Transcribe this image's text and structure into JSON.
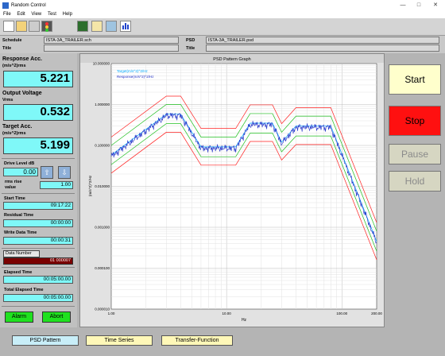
{
  "window": {
    "title": "Random Control"
  },
  "menu": [
    "File",
    "Edit",
    "View",
    "Test",
    "Help"
  ],
  "toolbar": {
    "icons": [
      "new-icon",
      "open-icon",
      "print-icon",
      "traffic-light-icon",
      "monitor-icon",
      "graph-icon",
      "window-icon",
      "bar-chart-icon"
    ]
  },
  "info": {
    "schedule_label": "Schedule",
    "schedule_value": "ISTA-3A_TRAILER.sch",
    "title_label": "Title",
    "title_value": "",
    "psd_label": "PSD",
    "psd_value": "ISTA-3A_TRAILER.psd",
    "title2_label": "Title",
    "title2_value": ""
  },
  "left": {
    "response_label": "Response Acc.",
    "response_unit": "(m/s^2)rms",
    "response_value": "5.221",
    "output_label": "Output Voltage",
    "output_unit": "Vrms",
    "output_value": "0.532",
    "target_label": "Target Acc.",
    "target_unit": "(m/s^2)rms",
    "target_value": "5.199",
    "drive_label": "Drive Level dB",
    "drive_value": "0.00",
    "rms_label": "rms rise",
    "rms_label2": "value",
    "rms_value": "1.00",
    "start_label": "Start Time",
    "start_value": "09:17:22",
    "residual_label": "Residual Time",
    "residual_value": "00:00:00",
    "write_label": "Write Data Time",
    "write_value": "00:00:31",
    "data_label": "Data Number",
    "data_value": "01 000007",
    "elapsed_label": "Elapsed Time",
    "elapsed_value": "00:05:00.00",
    "total_label": "Total Elapsed Time",
    "total_value": "00:05:00.00",
    "alarm_label": "Alarm",
    "abort_label": "Abort"
  },
  "right": {
    "start": "Start",
    "stop": "Stop",
    "pause": "Pause",
    "hold": "Hold"
  },
  "tabs": [
    "PSD Pattern",
    "Time Series",
    "Transfer-Function"
  ],
  "colors": {
    "value_bg": "#7ff8f8",
    "stop": "#ff1010",
    "start": "#ffffcc",
    "target": "#00aaff",
    "response": "#2030c8",
    "abort_limit": "#ff2020",
    "alarm_limit": "#20c020"
  },
  "chart_data": {
    "type": "line",
    "title": "PSD Pattern Graph",
    "xlabel": "Hz",
    "ylabel": "(m/s^2)^2/Hz",
    "xscale": "log",
    "yscale": "log",
    "xlim": [
      1,
      200
    ],
    "ylim": [
      1e-05,
      10
    ],
    "xticks": [
      "1.00",
      "10.00",
      "100.00",
      "200.00"
    ],
    "yticks": [
      "10.000000",
      "1.000000",
      "0.100000",
      "0.010000",
      "0.001000",
      "0.000100",
      "0.000010"
    ],
    "legend": [
      "Target(m/s^2)^2/Hz",
      "Response(m/s^2)^2/Hz"
    ],
    "series": [
      {
        "name": "Target(m/s^2)^2/Hz",
        "x": [
          1,
          3,
          4,
          6,
          12,
          16,
          25,
          30,
          40,
          80,
          200
        ],
        "y": [
          0.058,
          0.58,
          0.58,
          0.092,
          0.092,
          0.35,
          0.35,
          0.12,
          0.3,
          0.3,
          0.00045
        ]
      },
      {
        "name": "Response(m/s^2)^2/Hz",
        "x": [
          1,
          3,
          4,
          6,
          12,
          16,
          25,
          30,
          40,
          80,
          200
        ],
        "y": [
          0.058,
          0.58,
          0.58,
          0.092,
          0.092,
          0.35,
          0.35,
          0.12,
          0.3,
          0.3,
          0.00045
        ]
      },
      {
        "name": "",
        "x": [
          1,
          3,
          4,
          6,
          12,
          16,
          25,
          30,
          40,
          80,
          200
        ],
        "y": [
          0.16,
          1.6,
          1.6,
          0.26,
          0.26,
          0.98,
          0.98,
          0.34,
          0.84,
          0.84,
          0.0013
        ]
      },
      {
        "name": "",
        "x": [
          1,
          3,
          4,
          6,
          12,
          16,
          25,
          30,
          40,
          80,
          200
        ],
        "y": [
          0.1,
          1.0,
          1.0,
          0.16,
          0.16,
          0.6,
          0.6,
          0.21,
          0.52,
          0.52,
          0.0008
        ]
      },
      {
        "name": "",
        "x": [
          1,
          3,
          4,
          6,
          12,
          16,
          25,
          30,
          40,
          80,
          200
        ],
        "y": [
          0.034,
          0.34,
          0.34,
          0.053,
          0.053,
          0.2,
          0.2,
          0.07,
          0.17,
          0.17,
          0.00026
        ]
      },
      {
        "name": "",
        "x": [
          1,
          3,
          4,
          6,
          12,
          16,
          25,
          30,
          40,
          80,
          200
        ],
        "y": [
          0.021,
          0.21,
          0.21,
          0.033,
          0.033,
          0.125,
          0.125,
          0.044,
          0.105,
          0.105,
          0.00016
        ]
      }
    ]
  }
}
